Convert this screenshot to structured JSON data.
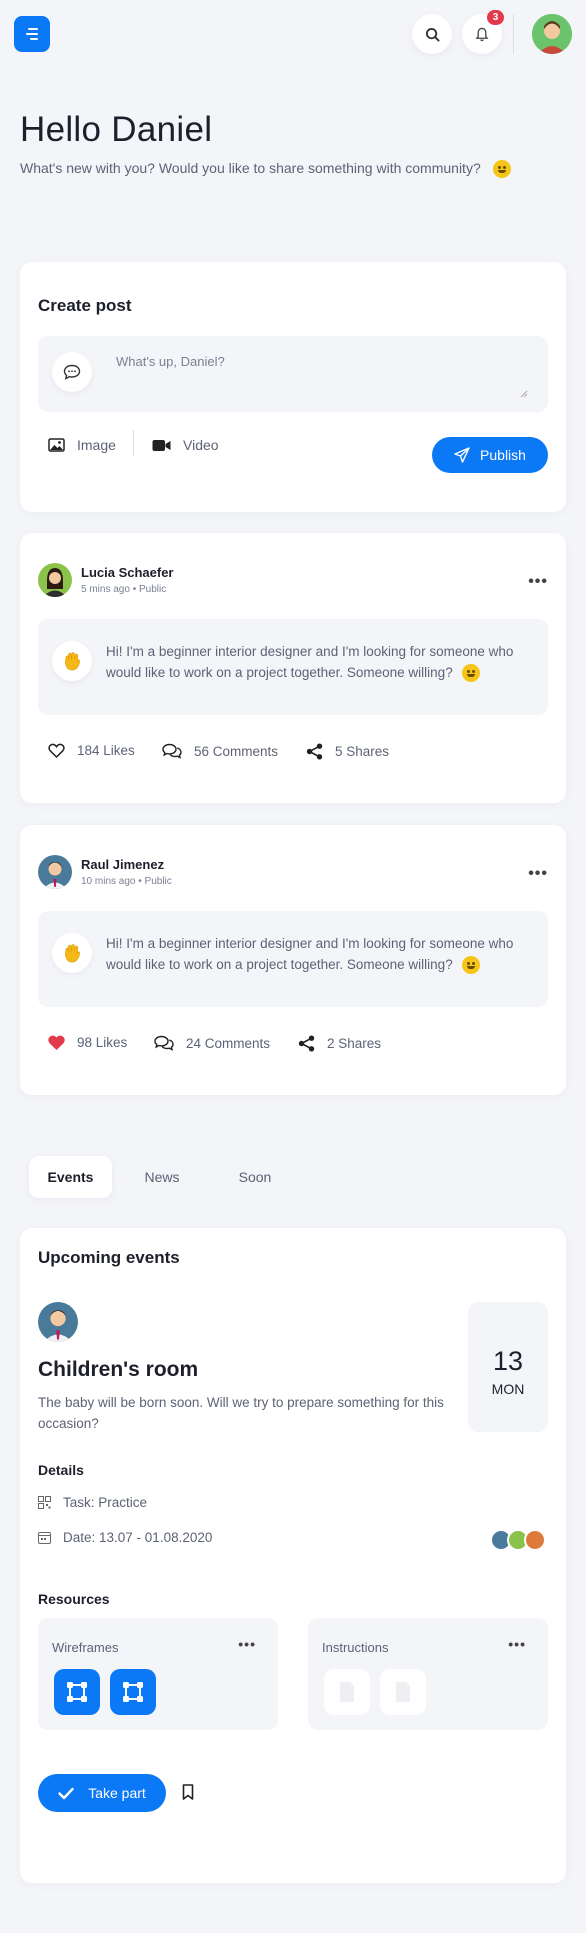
{
  "header": {
    "menu_icon": "menu-icon",
    "search_icon": "search-icon",
    "bell_icon": "bell-icon",
    "notification_count": "3",
    "accent_color": "#0b78f5",
    "badge_color": "#e23a4a"
  },
  "greeting": {
    "title": "Hello Daniel",
    "subtitle": "What's new with you? Would you like to share something with community?"
  },
  "create_post": {
    "title": "Create post",
    "placeholder": "What's up, Daniel?",
    "image_label": "Image",
    "video_label": "Video",
    "publish_label": "Publish"
  },
  "posts": [
    {
      "author": "Lucia Schaefer",
      "meta": "5 mins ago • Public",
      "text": "Hi! I'm a beginner interior designer and I'm looking for someone who would like to work on a project together. Someone willing?",
      "likes": "184 Likes",
      "comments": "56 Comments",
      "shares": "5 Shares",
      "liked": false
    },
    {
      "author": "Raul Jimenez",
      "meta": "10 mins ago • Public",
      "text": "Hi! I'm a beginner interior designer and I'm looking for someone who would like to work on a project together. Someone willing?",
      "likes": "98 Likes",
      "comments": "24 Comments",
      "shares": "2 Shares",
      "liked": true
    }
  ],
  "tabs": [
    {
      "label": "Events",
      "active": true
    },
    {
      "label": "News",
      "active": false
    },
    {
      "label": "Soon",
      "active": false
    }
  ],
  "events": {
    "title": "Upcoming events",
    "event_title": "Children's room",
    "event_desc": "The baby will be born soon. Will we try to prepare something for this occasion?",
    "day": "13",
    "weekday": "MON",
    "details_label": "Details",
    "task": "Task: Practice",
    "date": "Date: 13.07 - 01.08.2020",
    "resources_label": "Resources",
    "resources": [
      {
        "title": "Wireframes"
      },
      {
        "title": "Instructions"
      }
    ],
    "take_part_label": "Take part"
  }
}
